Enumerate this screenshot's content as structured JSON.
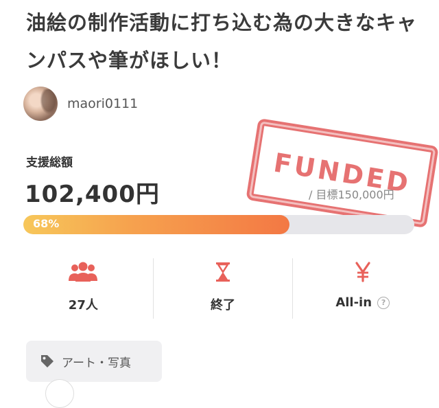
{
  "project": {
    "title": "油絵の制作活動に打ち込む為の大きなキャンパスや筆がほしい！",
    "owner": "maori0111"
  },
  "funding": {
    "label": "支援総額",
    "amount": "102,400円",
    "goal": "/ 目標150,000円",
    "progress_text": "68%",
    "progress_value": 0.68,
    "stamp": "FUNDED"
  },
  "stats": {
    "supporters": "27人",
    "status": "終了",
    "type": "All-in",
    "type_help": "?"
  },
  "tag": {
    "label": "アート・写真"
  },
  "colors": {
    "accent": "#e25a5a",
    "progress_start": "#f7c75a",
    "progress_end": "#f37844"
  }
}
